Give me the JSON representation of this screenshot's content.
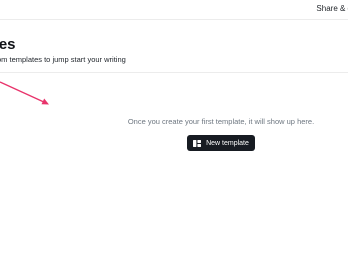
{
  "header": {
    "share_label": "Share & d"
  },
  "page": {
    "title": "ates",
    "subtitle": "om templates to jump start your writing"
  },
  "empty_state": {
    "message": "Once you create your first template, it will show up here.",
    "button_label": "New template",
    "button_icon": "template-icon"
  },
  "colors": {
    "arrow": "#e8336b",
    "button_bg": "#171b22",
    "muted_text": "#6e7781"
  }
}
